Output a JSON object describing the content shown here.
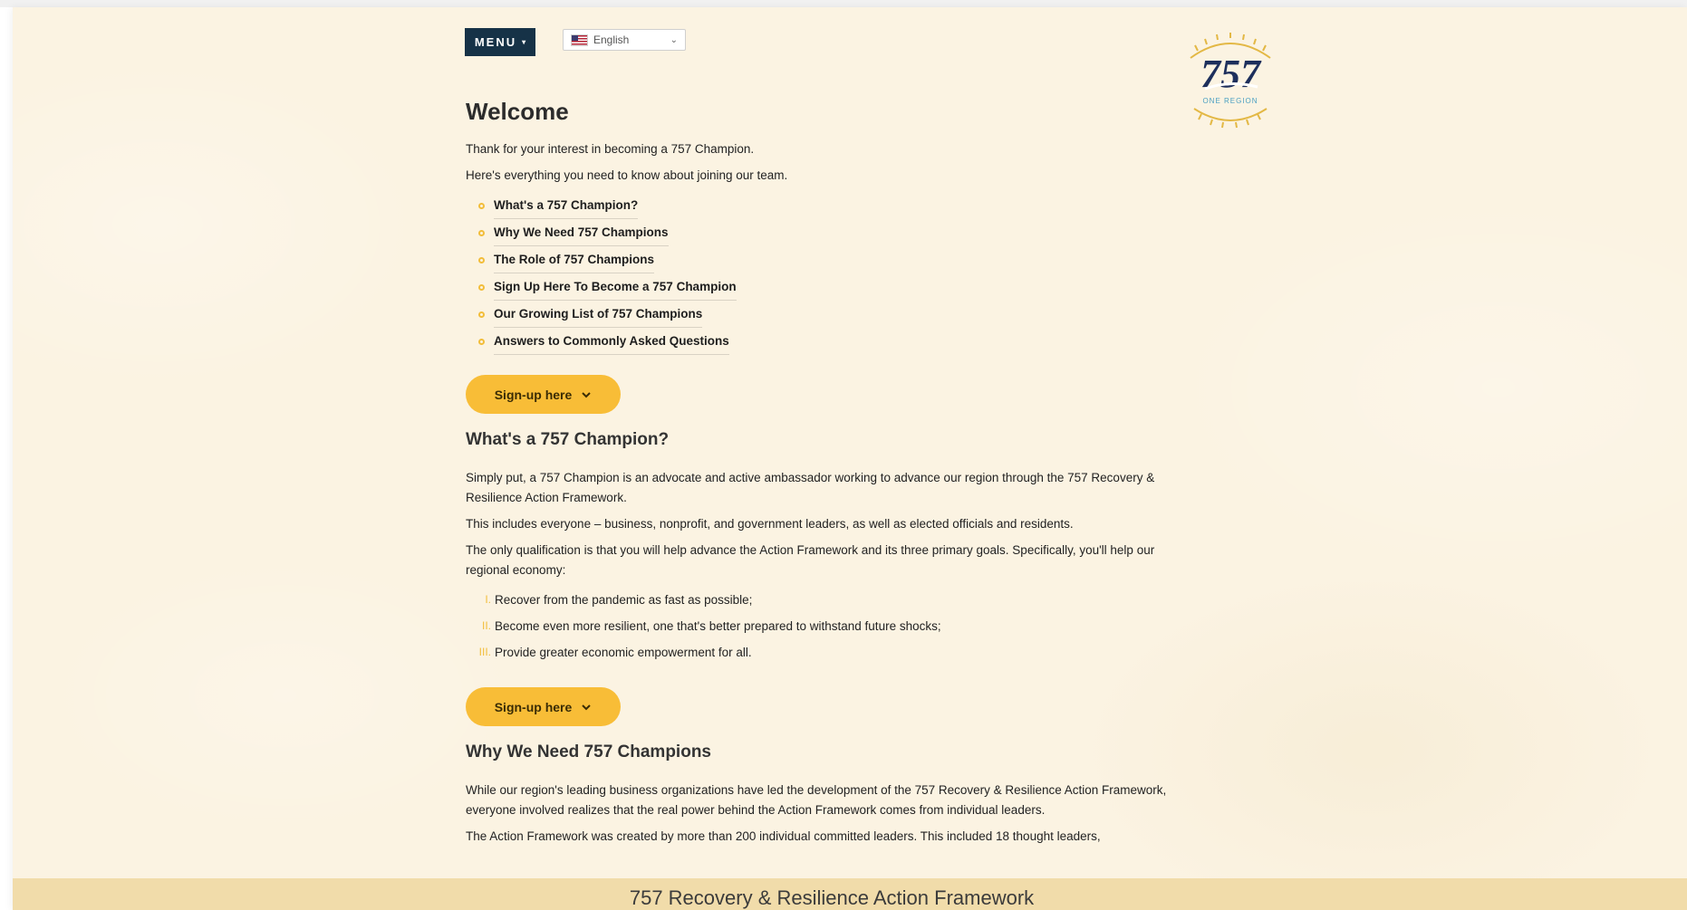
{
  "header": {
    "menu_label": "MENU",
    "language": "English"
  },
  "logo": {
    "numerals": "757",
    "tagline": "ONE REGION"
  },
  "welcome": {
    "title": "Welcome",
    "intro1": "Thank for your interest in becoming a 757 Champion.",
    "intro2": "Here's everything you need to know about joining our team.",
    "toc": [
      "What's a 757 Champion?",
      "Why We Need 757 Champions",
      "The Role of 757 Champions",
      "Sign Up Here To Become a 757 Champion",
      "Our Growing List of 757 Champions",
      "Answers to Commonly Asked Questions"
    ]
  },
  "signup_label": "Sign-up here",
  "section1": {
    "heading": "What's a 757 Champion?",
    "p1": "Simply put, a 757 Champion is an advocate and active ambassador working to advance our region through the 757 Recovery & Resilience Action Framework.",
    "p2": "This includes everyone – business, nonprofit, and government leaders, as well as elected officials and residents.",
    "p3": "The only qualification is that you will help advance the Action Framework and its three primary goals. Specifically, you'll help our regional economy:",
    "goals": [
      {
        "num": "I.",
        "text": "Recover from the pandemic as fast as possible;"
      },
      {
        "num": "II.",
        "text": "Become even more resilient, one that's better prepared to withstand future shocks;"
      },
      {
        "num": "III.",
        "text": "Provide greater economic empowerment for all."
      }
    ]
  },
  "section2": {
    "heading": "Why We Need 757 Champions",
    "p1": "While our region's leading business organizations have led the development of the 757 Recovery & Resilience Action Framework, everyone involved realizes that the real power behind the Action Framework comes from individual leaders.",
    "p2": "The Action Framework was created by more than 200 individual committed leaders. This included 18 thought leaders,"
  },
  "footer": {
    "title": "757 Recovery & Resilience Action Framework"
  },
  "colors": {
    "page_bg": "#fbf3e2",
    "menu_bg": "#163247",
    "accent": "#f8bd37",
    "footer_bg": "#f1dcaa",
    "logo_navy": "#1d2f5c",
    "logo_gold": "#e3b845"
  }
}
